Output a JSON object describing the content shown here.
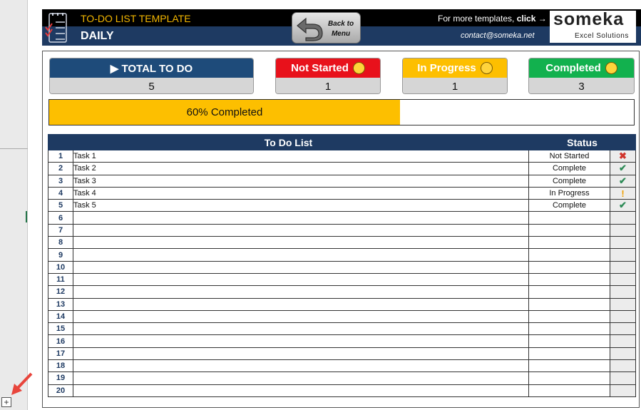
{
  "header": {
    "title": "TO-DO LIST TEMPLATE",
    "subtitle": "DAILY",
    "back_button": "Back to Menu",
    "more_templates": "For more templates,",
    "more_click": "click →",
    "contact": "contact@someka.net",
    "brand_name": "someka",
    "brand_tagline": "Excel Solutions"
  },
  "stats": [
    {
      "label": "▶ TOTAL TO DO",
      "value": "5",
      "color": "#1e4b7a",
      "emoji": ""
    },
    {
      "label": "Not Started",
      "value": "1",
      "color": "#e8111b",
      "emoji": "neutral-face"
    },
    {
      "label": "In Progress",
      "value": "1",
      "color": "#fdbf00",
      "emoji": "smiling-face"
    },
    {
      "label": "Completed",
      "value": "3",
      "color": "#12b14e",
      "emoji": "heart-eyes-face"
    }
  ],
  "progress": {
    "label": "60% Completed",
    "percent": 60,
    "color": "#fdbf00"
  },
  "table": {
    "columns": [
      "To Do List",
      "Status"
    ],
    "rows": [
      {
        "num": "1",
        "task": "Task 1",
        "status": "Not Started",
        "icon": "x-mark-icon"
      },
      {
        "num": "2",
        "task": "Task 2",
        "status": "Complete",
        "icon": "check-icon"
      },
      {
        "num": "3",
        "task": "Task 3",
        "status": "Complete",
        "icon": "check-icon"
      },
      {
        "num": "4",
        "task": "Task 4",
        "status": "In Progress",
        "icon": "exclamation-icon"
      },
      {
        "num": "5",
        "task": "Task 5",
        "status": "Complete",
        "icon": "check-icon"
      },
      {
        "num": "6",
        "task": "",
        "status": "",
        "icon": ""
      },
      {
        "num": "7",
        "task": "",
        "status": "",
        "icon": ""
      },
      {
        "num": "8",
        "task": "",
        "status": "",
        "icon": ""
      },
      {
        "num": "9",
        "task": "",
        "status": "",
        "icon": ""
      },
      {
        "num": "10",
        "task": "",
        "status": "",
        "icon": ""
      },
      {
        "num": "11",
        "task": "",
        "status": "",
        "icon": ""
      },
      {
        "num": "12",
        "task": "",
        "status": "",
        "icon": ""
      },
      {
        "num": "13",
        "task": "",
        "status": "",
        "icon": ""
      },
      {
        "num": "14",
        "task": "",
        "status": "",
        "icon": ""
      },
      {
        "num": "15",
        "task": "",
        "status": "",
        "icon": ""
      },
      {
        "num": "16",
        "task": "",
        "status": "",
        "icon": ""
      },
      {
        "num": "17",
        "task": "",
        "status": "",
        "icon": ""
      },
      {
        "num": "18",
        "task": "",
        "status": "",
        "icon": ""
      },
      {
        "num": "19",
        "task": "",
        "status": "",
        "icon": ""
      },
      {
        "num": "20",
        "task": "",
        "status": "",
        "icon": ""
      }
    ]
  },
  "sheet_controls": {
    "expand_button": "+"
  }
}
